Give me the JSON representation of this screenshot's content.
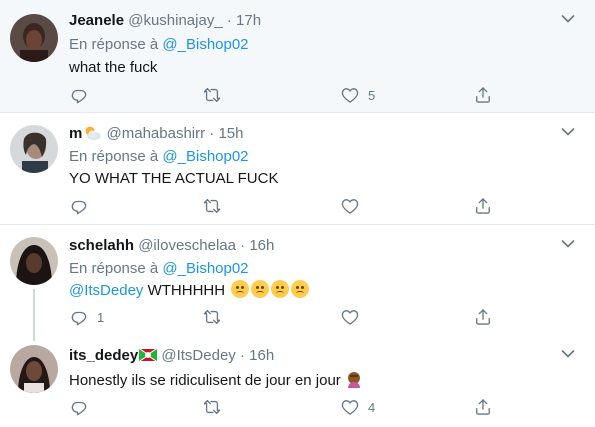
{
  "tweets": [
    {
      "name": "Jeanele",
      "handle": "@kushinajay_",
      "separator": "·",
      "time": "17h",
      "reply_prefix": "En réponse à",
      "reply_to": "@_Bishop02",
      "text": "what the fuck",
      "likes": "5",
      "retweets": "",
      "replies": ""
    },
    {
      "name": "m",
      "handle": "@mahabashirr",
      "separator": "·",
      "time": "15h",
      "reply_prefix": "En réponse à",
      "reply_to": "@_Bishop02",
      "text": "YO WHAT THE ACTUAL FUCK",
      "likes": "",
      "retweets": "",
      "replies": ""
    },
    {
      "name": "schelahh",
      "handle": "@iloveschelaa",
      "separator": "·",
      "time": "16h",
      "reply_prefix": "En réponse à",
      "reply_to": "@_Bishop02",
      "mention": "@ItsDedey",
      "text": "WTHHHHH",
      "likes": "",
      "retweets": "",
      "replies": "1"
    },
    {
      "name": "its_dedey",
      "handle": "@ItsDedey",
      "separator": "·",
      "time": "16h",
      "text": "Honestly ils se ridiculisent de jour en jour",
      "likes": "4",
      "retweets": "",
      "replies": ""
    }
  ],
  "icons": {
    "reply": "reply-icon",
    "retweet": "retweet-icon",
    "like": "heart-icon",
    "share": "share-icon",
    "more": "chevron-down-icon"
  },
  "colors": {
    "link": "#1b95e0",
    "secondary": "#657786",
    "highlight_bg": "#f5f8fa",
    "border": "#e6ecf0"
  }
}
